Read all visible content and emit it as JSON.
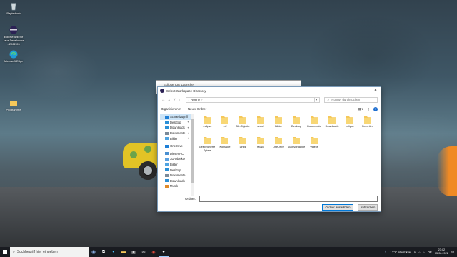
{
  "desktop": {
    "icons": [
      {
        "label": "Papierkorb",
        "icon": "recycle-bin-icon"
      },
      {
        "label": "Eclipse IDE for Java Developers - 2022-03",
        "icon": "eclipse-icon"
      },
      {
        "label": "Microsoft Edge",
        "icon": "edge-icon"
      },
      {
        "label": "Programme",
        "icon": "folder-icon"
      }
    ]
  },
  "launcher": {
    "title": "Eclipse IDE Launcher"
  },
  "dialog": {
    "title": "Select Workspace Directory",
    "breadcrumb": "Ronny",
    "search_placeholder": "\"Ronny\" durchsuchen",
    "organize_label": "Organisieren ▾",
    "new_folder_label": "Neuer Ordner",
    "sidebar": [
      {
        "label": "Schnellzugriff",
        "selected": true,
        "icon": "star-icon",
        "color": "#1e7fd6"
      },
      {
        "label": "Desktop",
        "pinned": true,
        "icon": "desktop-icon",
        "color": "#2a8fd6"
      },
      {
        "label": "Downloads",
        "pinned": true,
        "icon": "download-icon",
        "color": "#2a8fd6"
      },
      {
        "label": "Dokumente",
        "pinned": true,
        "icon": "documents-icon",
        "color": "#7a8a99"
      },
      {
        "label": "Bilder",
        "pinned": true,
        "icon": "pictures-icon",
        "color": "#4fa3e0"
      },
      {
        "label": "OneDrive",
        "icon": "onedrive-icon",
        "color": "#1e7fd6"
      },
      {
        "label": "Dieser PC",
        "icon": "computer-icon",
        "color": "#4a8fd0"
      },
      {
        "label": "3D-Objekte",
        "icon": "3d-objects-icon",
        "color": "#5aa0e0"
      },
      {
        "label": "Bilder",
        "icon": "pictures-icon",
        "color": "#4fa3e0"
      },
      {
        "label": "Desktop",
        "icon": "desktop-icon",
        "color": "#2a8fd6"
      },
      {
        "label": "Dokumente",
        "icon": "documents-icon",
        "color": "#7a8a99"
      },
      {
        "label": "Downloads",
        "icon": "download-icon",
        "color": "#2a8fd6"
      },
      {
        "label": "Musik",
        "icon": "music-icon",
        "color": "#e08a2a"
      }
    ],
    "files": [
      {
        "label": ".eclipse",
        "icon": "folder-icon"
      },
      {
        "label": ".p2",
        "icon": "folder-icon"
      },
      {
        "label": "3D-Objekte",
        "icon": "3d-objects-folder-icon"
      },
      {
        "label": "ansel",
        "icon": "folder-icon"
      },
      {
        "label": "Bilder",
        "icon": "pictures-folder-icon"
      },
      {
        "label": "Desktop",
        "icon": "desktop-folder-icon"
      },
      {
        "label": "Dokumente",
        "icon": "documents-folder-icon"
      },
      {
        "label": "Downloads",
        "icon": "downloads-folder-icon"
      },
      {
        "label": "eclipse",
        "icon": "folder-icon"
      },
      {
        "label": "Favoriten",
        "icon": "favorites-folder-icon"
      },
      {
        "label": "Gespeicherte Spiele",
        "icon": "saved-games-folder-icon"
      },
      {
        "label": "Kontakte",
        "icon": "contacts-folder-icon"
      },
      {
        "label": "Links",
        "icon": "links-folder-icon"
      },
      {
        "label": "Musik",
        "icon": "music-folder-icon"
      },
      {
        "label": "OneDrive",
        "icon": "onedrive-folder-icon"
      },
      {
        "label": "Suchvorgänge",
        "icon": "searches-folder-icon"
      },
      {
        "label": "Videos",
        "icon": "videos-folder-icon"
      }
    ],
    "folder_label": "Ordner:",
    "folder_value": "",
    "ok_label": "Ordner auswählen",
    "cancel_label": "Abbrechen"
  },
  "taskbar": {
    "search_placeholder": "Suchbegriff hier eingeben",
    "weather": "17°C  Meist klar",
    "time": "23:02",
    "date": "05.06.2022"
  },
  "colors": {
    "accent": "#0078d7",
    "folder": "#f5c85a",
    "taskbar": "#181a20"
  }
}
